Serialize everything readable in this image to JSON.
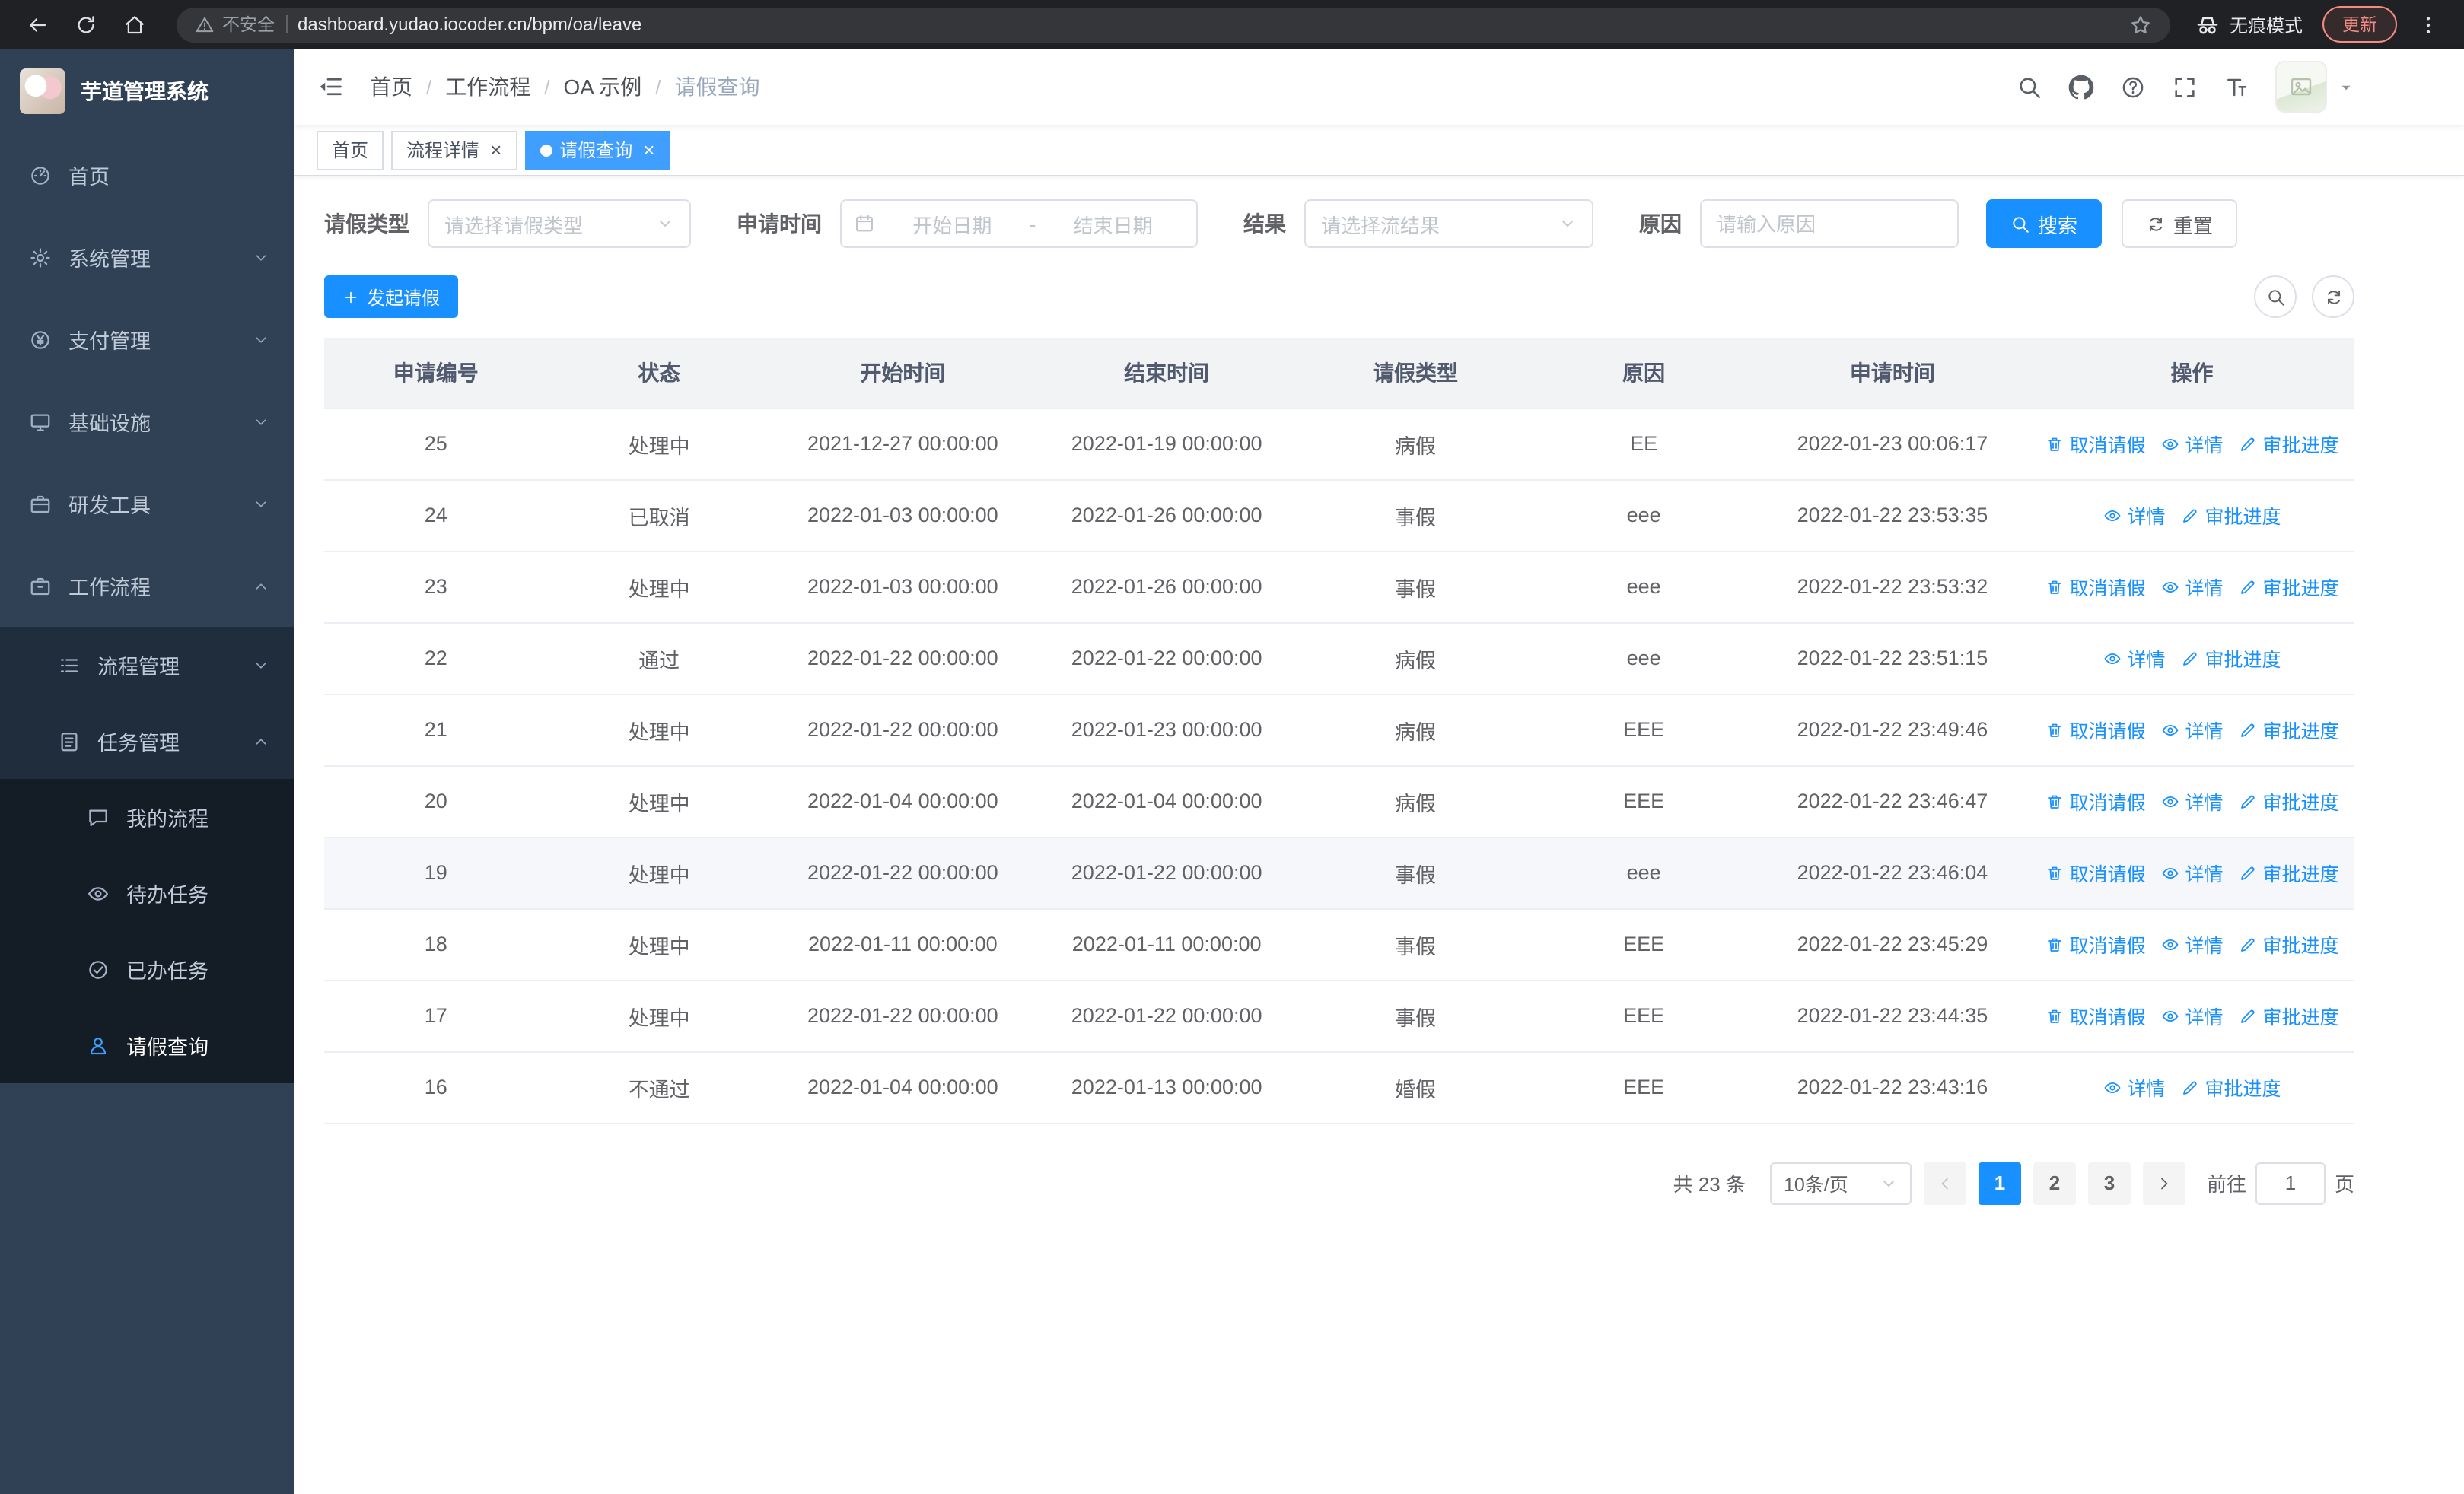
{
  "browser": {
    "url": "dashboard.yudao.iocoder.cn/bpm/oa/leave",
    "security_warning": "不安全",
    "incognito_label": "无痕模式",
    "update_label": "更新"
  },
  "sidebar": {
    "logo_title": "芋道管理系统",
    "menu": [
      {
        "key": "home",
        "label": "首页",
        "icon": "dashboard",
        "level": 1
      },
      {
        "key": "system",
        "label": "系统管理",
        "icon": "gear",
        "level": 1,
        "chevron": "down"
      },
      {
        "key": "payment",
        "label": "支付管理",
        "icon": "money",
        "level": 1,
        "chevron": "down"
      },
      {
        "key": "infra",
        "label": "基础设施",
        "icon": "monitor",
        "level": 1,
        "chevron": "down"
      },
      {
        "key": "devtools",
        "label": "研发工具",
        "icon": "tools",
        "level": 1,
        "chevron": "down"
      },
      {
        "key": "workflow",
        "label": "工作流程",
        "icon": "workflow",
        "level": 1,
        "chevron": "up"
      },
      {
        "key": "process-mgmt",
        "label": "流程管理",
        "icon": "list",
        "level": 2,
        "chevron": "down"
      },
      {
        "key": "task-mgmt",
        "label": "任务管理",
        "icon": "task",
        "level": 2,
        "chevron": "up"
      },
      {
        "key": "my-process",
        "label": "我的流程",
        "icon": "chat",
        "level": 3
      },
      {
        "key": "todo-tasks",
        "label": "待办任务",
        "icon": "eye",
        "level": 3
      },
      {
        "key": "done-tasks",
        "label": "已办任务",
        "icon": "done",
        "level": 3
      },
      {
        "key": "leave-query",
        "label": "请假查询",
        "icon": "user",
        "level": 3,
        "active": true
      }
    ]
  },
  "header": {
    "breadcrumb": [
      "首页",
      "工作流程",
      "OA 示例",
      "请假查询"
    ]
  },
  "tabs": [
    {
      "key": "home",
      "label": "首页",
      "closable": false,
      "active": false
    },
    {
      "key": "process-detail",
      "label": "流程详情",
      "closable": true,
      "active": false
    },
    {
      "key": "leave-query",
      "label": "请假查询",
      "closable": true,
      "active": true
    }
  ],
  "filters": {
    "leave_type_label": "请假类型",
    "leave_type_placeholder": "请选择请假类型",
    "apply_time_label": "申请时间",
    "start_date_placeholder": "开始日期",
    "range_separator": "-",
    "end_date_placeholder": "结束日期",
    "result_label": "结果",
    "result_placeholder": "请选择流结果",
    "reason_label": "原因",
    "reason_placeholder": "请输入原因",
    "search_button": "搜索",
    "reset_button": "重置"
  },
  "toolbar": {
    "create_button": "发起请假"
  },
  "table": {
    "columns": [
      "申请编号",
      "状态",
      "开始时间",
      "结束时间",
      "请假类型",
      "原因",
      "申请时间",
      "操作"
    ],
    "action_labels": {
      "cancel": "取消请假",
      "detail": "详情",
      "progress": "审批进度"
    },
    "rows": [
      {
        "id": "25",
        "status": "处理中",
        "start": "2021-12-27 00:00:00",
        "end": "2022-01-19 00:00:00",
        "type": "病假",
        "reason": "EE",
        "apply": "2022-01-23 00:06:17",
        "actions": [
          "cancel",
          "detail",
          "progress"
        ]
      },
      {
        "id": "24",
        "status": "已取消",
        "start": "2022-01-03 00:00:00",
        "end": "2022-01-26 00:00:00",
        "type": "事假",
        "reason": "eee",
        "apply": "2022-01-22 23:53:35",
        "actions": [
          "detail",
          "progress"
        ]
      },
      {
        "id": "23",
        "status": "处理中",
        "start": "2022-01-03 00:00:00",
        "end": "2022-01-26 00:00:00",
        "type": "事假",
        "reason": "eee",
        "apply": "2022-01-22 23:53:32",
        "actions": [
          "cancel",
          "detail",
          "progress"
        ]
      },
      {
        "id": "22",
        "status": "通过",
        "start": "2022-01-22 00:00:00",
        "end": "2022-01-22 00:00:00",
        "type": "病假",
        "reason": "eee",
        "apply": "2022-01-22 23:51:15",
        "actions": [
          "detail",
          "progress"
        ]
      },
      {
        "id": "21",
        "status": "处理中",
        "start": "2022-01-22 00:00:00",
        "end": "2022-01-23 00:00:00",
        "type": "病假",
        "reason": "EEE",
        "apply": "2022-01-22 23:49:46",
        "actions": [
          "cancel",
          "detail",
          "progress"
        ]
      },
      {
        "id": "20",
        "status": "处理中",
        "start": "2022-01-04 00:00:00",
        "end": "2022-01-04 00:00:00",
        "type": "病假",
        "reason": "EEE",
        "apply": "2022-01-22 23:46:47",
        "actions": [
          "cancel",
          "detail",
          "progress"
        ]
      },
      {
        "id": "19",
        "status": "处理中",
        "start": "2022-01-22 00:00:00",
        "end": "2022-01-22 00:00:00",
        "type": "事假",
        "reason": "eee",
        "apply": "2022-01-22 23:46:04",
        "actions": [
          "cancel",
          "detail",
          "progress"
        ],
        "highlighted": true
      },
      {
        "id": "18",
        "status": "处理中",
        "start": "2022-01-11 00:00:00",
        "end": "2022-01-11 00:00:00",
        "type": "事假",
        "reason": "EEE",
        "apply": "2022-01-22 23:45:29",
        "actions": [
          "cancel",
          "detail",
          "progress"
        ]
      },
      {
        "id": "17",
        "status": "处理中",
        "start": "2022-01-22 00:00:00",
        "end": "2022-01-22 00:00:00",
        "type": "事假",
        "reason": "EEE",
        "apply": "2022-01-22 23:44:35",
        "actions": [
          "cancel",
          "detail",
          "progress"
        ]
      },
      {
        "id": "16",
        "status": "不通过",
        "start": "2022-01-04 00:00:00",
        "end": "2022-01-13 00:00:00",
        "type": "婚假",
        "reason": "EEE",
        "apply": "2022-01-22 23:43:16",
        "actions": [
          "detail",
          "progress"
        ]
      }
    ]
  },
  "pagination": {
    "total_text": "共 23 条",
    "page_size": "10条/页",
    "pages": [
      "1",
      "2",
      "3"
    ],
    "active_page": "1",
    "goto_label": "前往",
    "goto_value": "1",
    "page_suffix": "页"
  },
  "colors": {
    "accent": "#1890ff",
    "tab_active": "#409eff",
    "sidebar_bg": "#304156",
    "chrome_bg": "#202124"
  }
}
